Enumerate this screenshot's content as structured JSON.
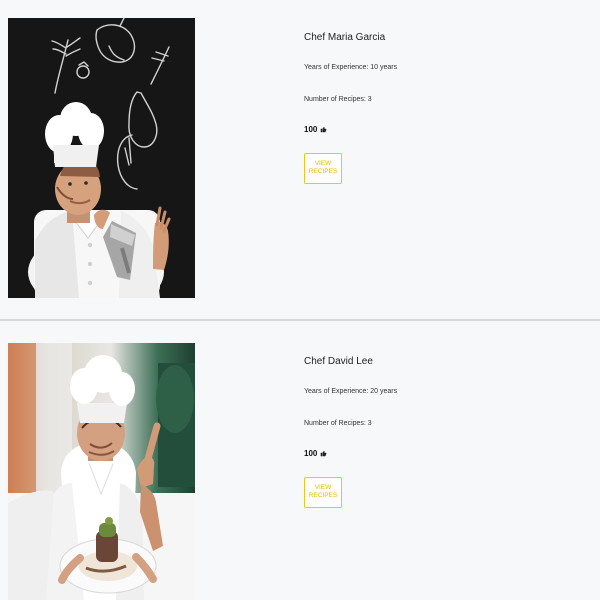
{
  "chefs": [
    {
      "name": "Chef Maria Garcia",
      "experience": "Years of Experience: 10 years",
      "recipes": "Number of Recipes: 3",
      "likes": "100",
      "button_label": "VIEW RECIPES",
      "photo_icon": "chef-photo"
    },
    {
      "name": "Chef David Lee",
      "experience": "Years of Experience: 20 years",
      "recipes": "Number of Recipes: 3",
      "likes": "100",
      "button_label": "VIEW RECIPES",
      "photo_icon": "chef-photo"
    }
  ],
  "colors": {
    "background": "#f7f8fa",
    "accent": "#f0c419",
    "divider": "#d7d7d7"
  }
}
